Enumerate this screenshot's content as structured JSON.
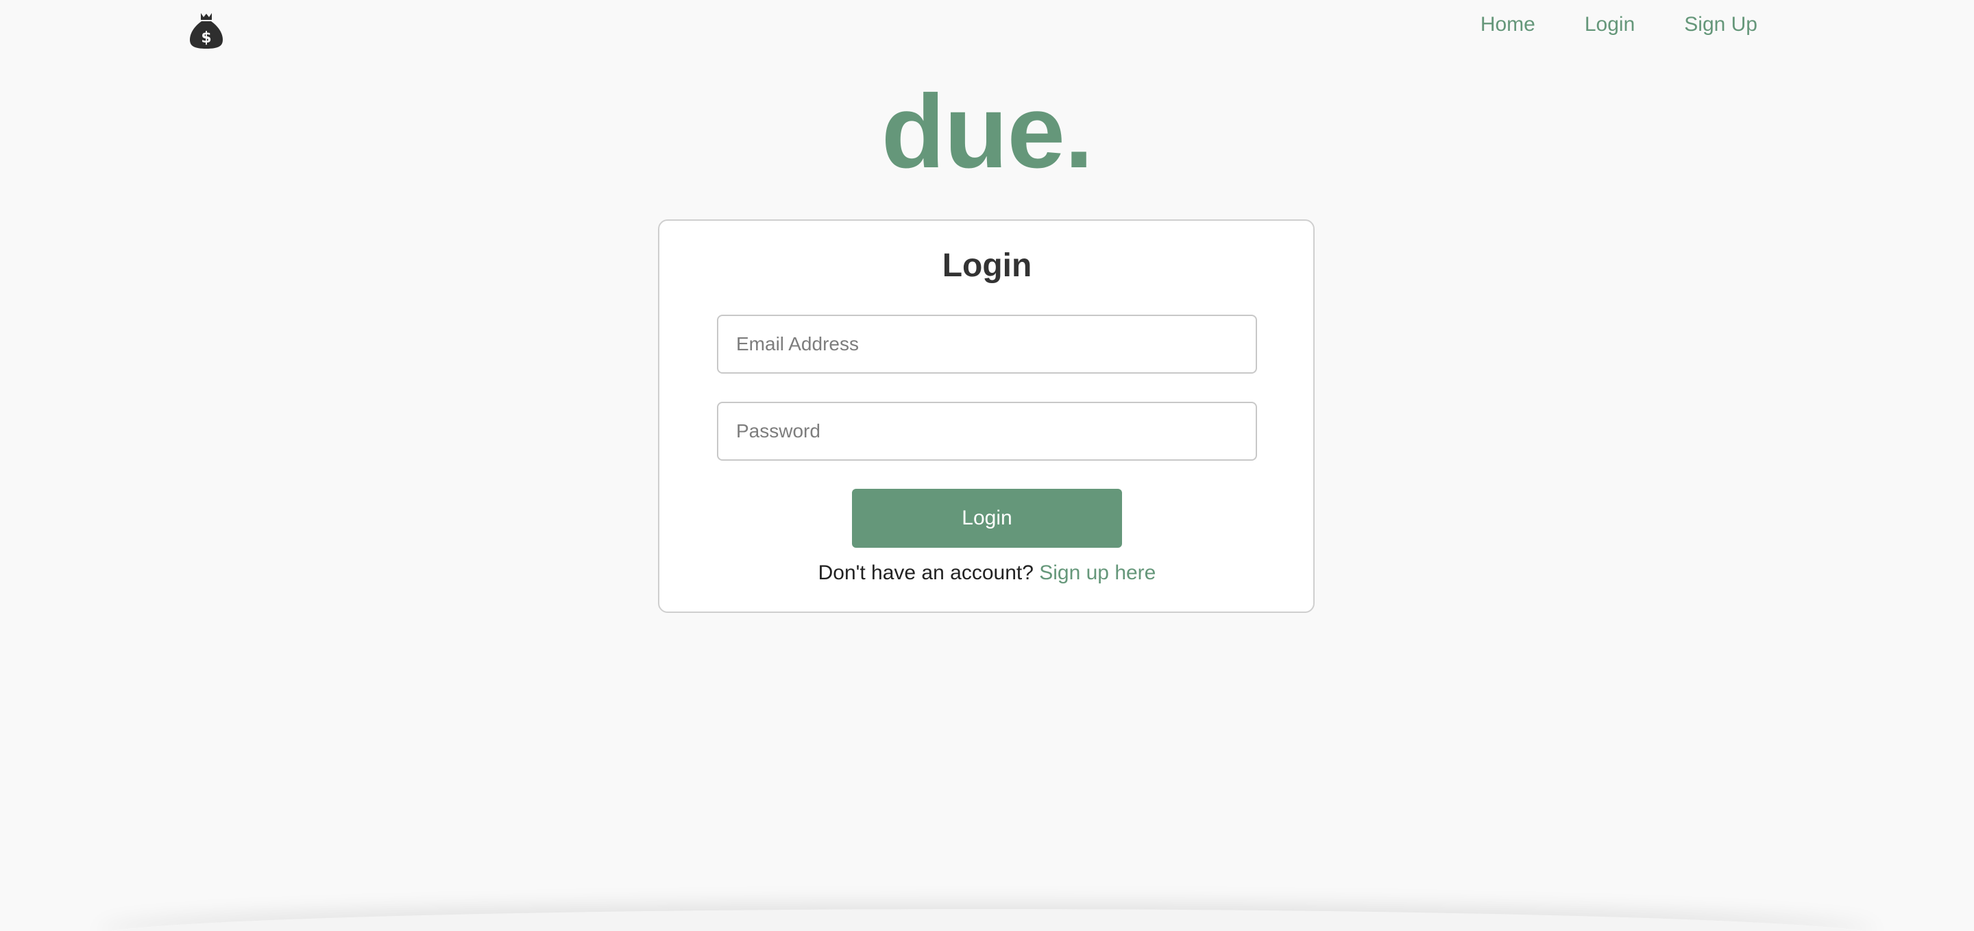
{
  "header": {
    "logo_icon": "money-bag-icon",
    "nav": [
      {
        "label": "Home"
      },
      {
        "label": "Login"
      },
      {
        "label": "Sign Up"
      }
    ]
  },
  "brand": {
    "title": "due."
  },
  "login_form": {
    "title": "Login",
    "email_placeholder": "Email Address",
    "email_value": "",
    "password_placeholder": "Password",
    "password_value": "",
    "submit_label": "Login",
    "signup_prompt": "Don't have an account?",
    "signup_link": "Sign up here"
  },
  "colors": {
    "accent": "#65977a",
    "background": "#f9f9f9",
    "card": "#ffffff",
    "text": "#333333"
  }
}
